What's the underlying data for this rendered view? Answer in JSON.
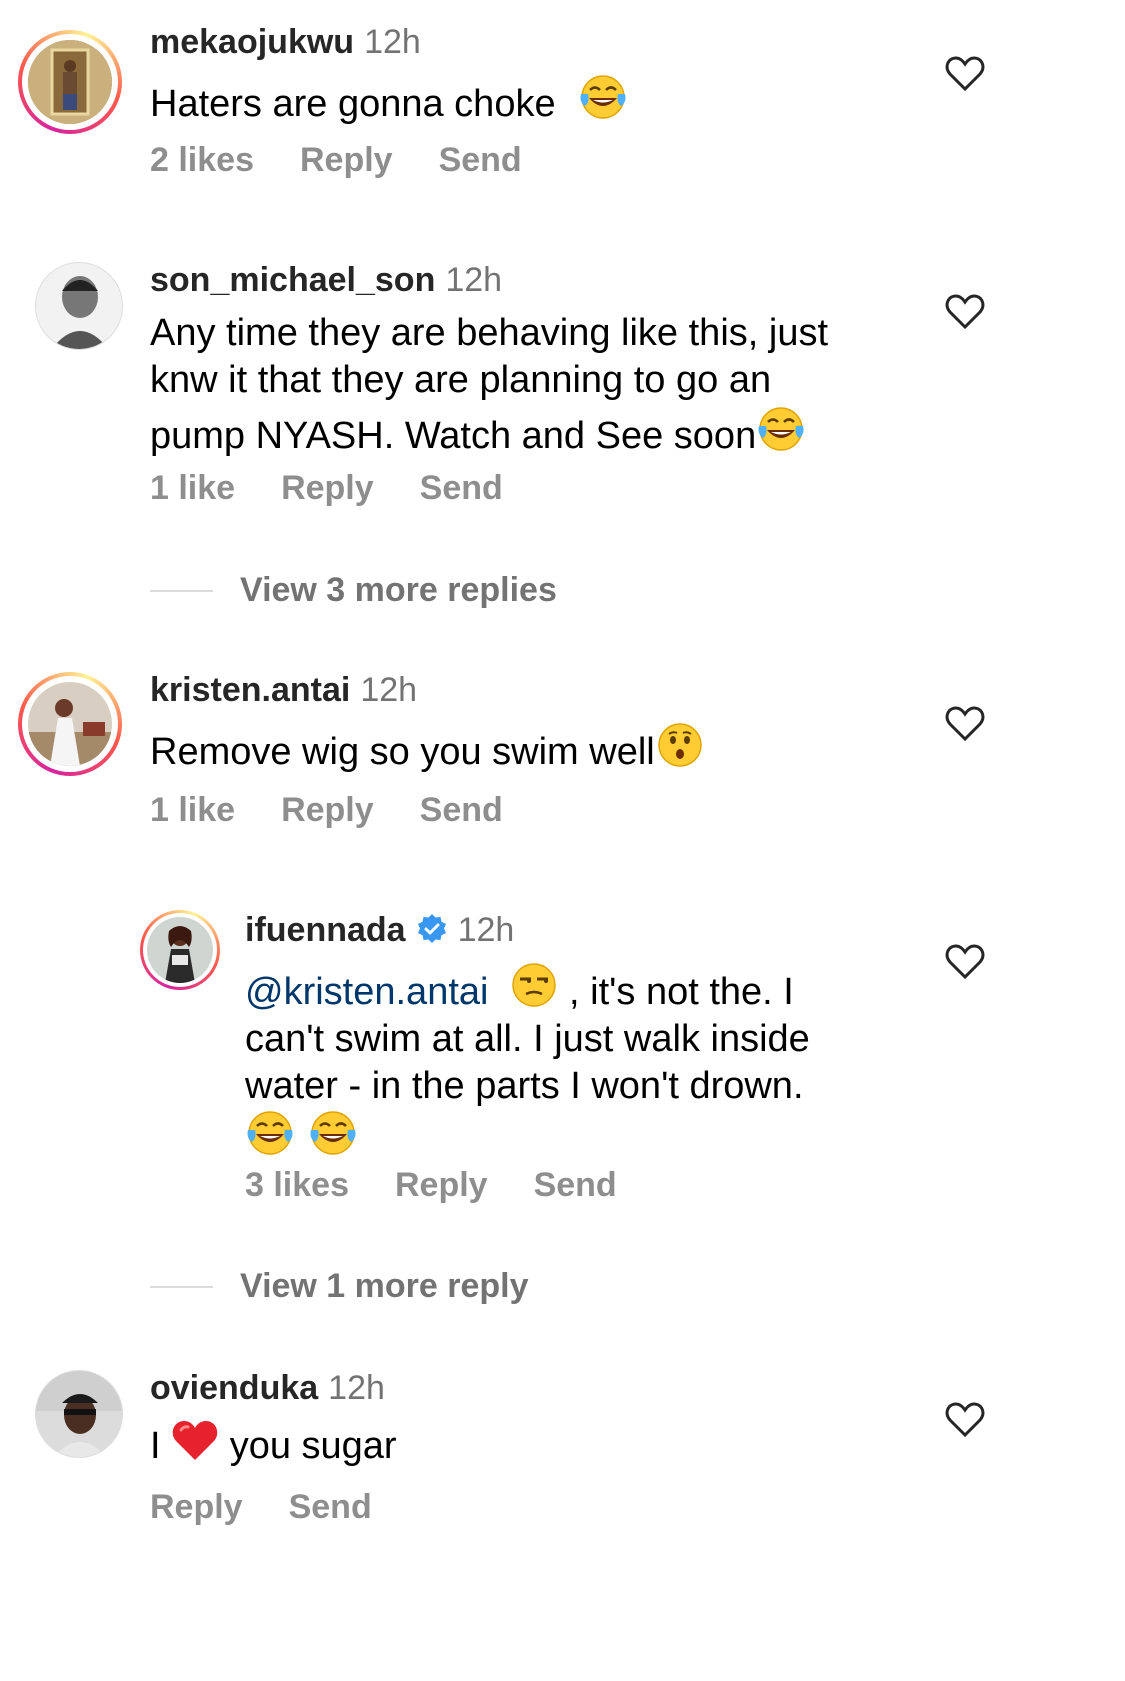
{
  "comments": [
    {
      "username": "mekaojukwu",
      "time": "12h",
      "text": "Haters are gonna choke",
      "emoji": "face-with-tears-of-joy",
      "likes": "2 likes",
      "reply": "Reply",
      "send": "Send"
    },
    {
      "username": "son_michael_son",
      "time": "12h",
      "lines": [
        "Any time they are behaving like this, just",
        "knw it that they are planning to go an",
        "pump NYASH. Watch and See soon"
      ],
      "emoji": "face-with-tears-of-joy",
      "likes": "1 like",
      "reply": "Reply",
      "send": "Send",
      "view_more": "View 3 more replies"
    },
    {
      "username": "kristen.antai",
      "time": "12h",
      "text": "Remove wig so you swim well",
      "emoji": "hushed-face",
      "likes": "1 like",
      "reply": "Reply",
      "send": "Send"
    },
    {
      "username": "ifuennada",
      "verified": true,
      "time": "12h",
      "mention": "@kristen.antai",
      "line1_rest": ", it's not the. I",
      "line2": "can't swim at all. I just walk inside",
      "line3": "water - in the parts I won't drown.",
      "emoji": "unamused-face",
      "likes": "3 likes",
      "reply": "Reply",
      "send": "Send",
      "view_more": "View 1 more reply"
    },
    {
      "username": "ovienduka",
      "time": "12h",
      "text_before": "I",
      "text_after": "you sugar",
      "emoji": "red-heart",
      "reply": "Reply",
      "send": "Send"
    }
  ],
  "colors": {
    "username": "#262626",
    "meta": "#8e8e8e",
    "mention": "#00376b",
    "verified": "#3897f0"
  }
}
